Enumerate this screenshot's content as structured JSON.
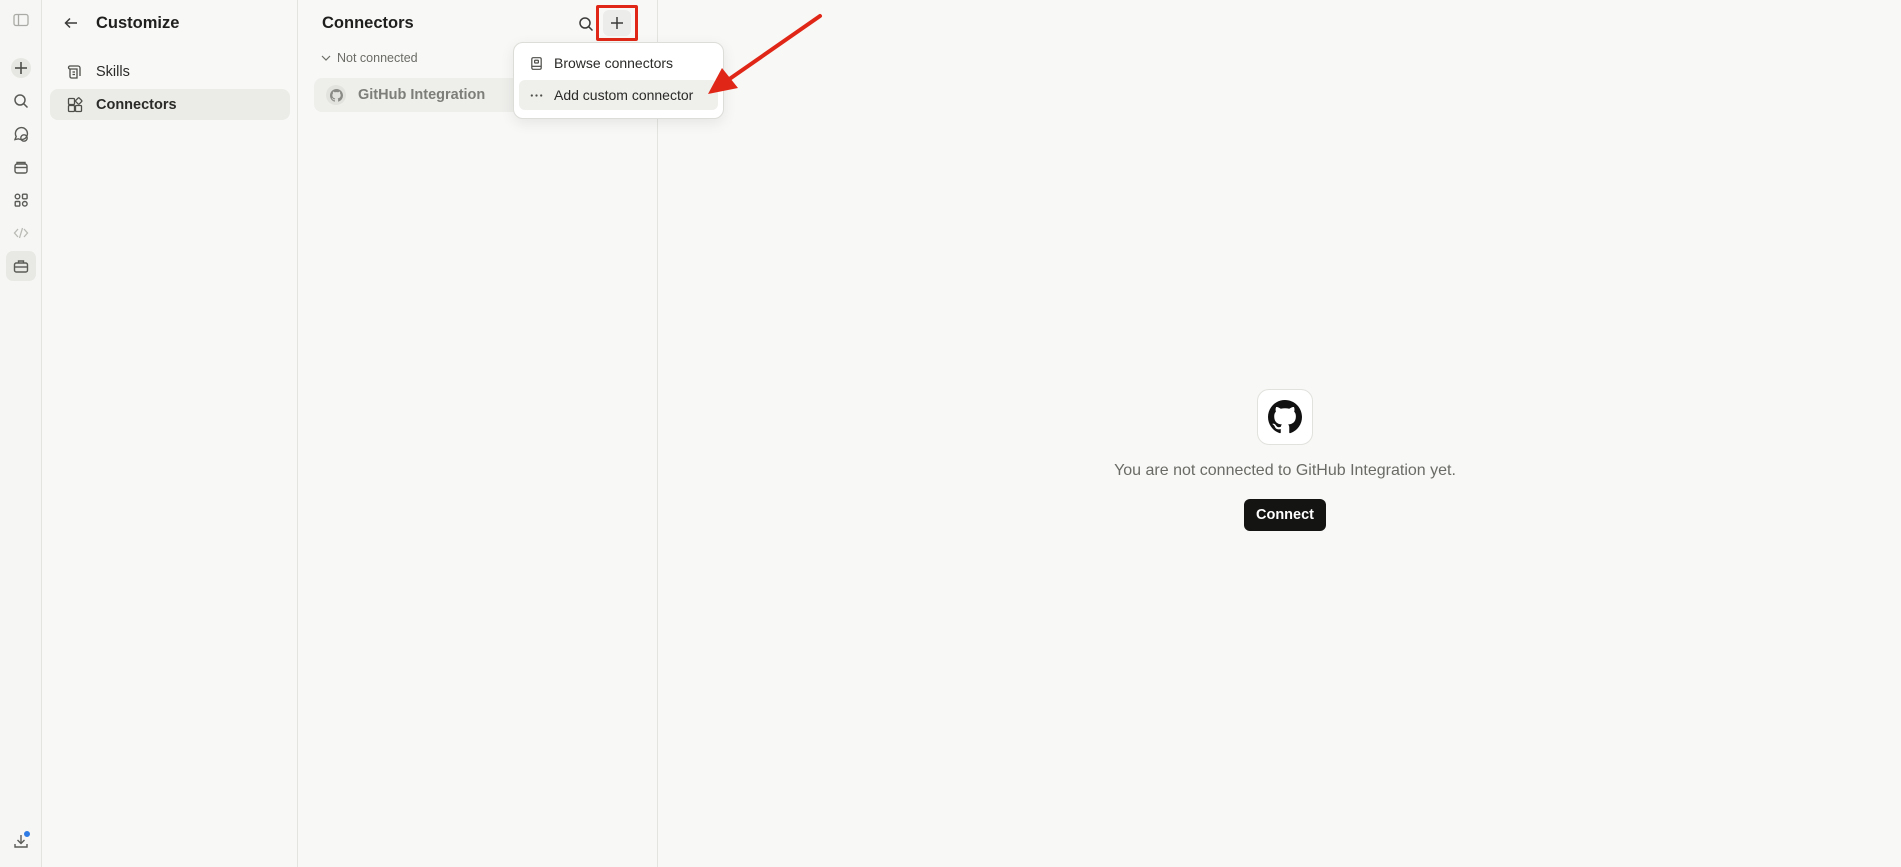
{
  "rail": {
    "items": [
      {
        "icon": "sidebar-toggle-icon"
      },
      {
        "icon": "plus-icon"
      },
      {
        "icon": "search-icon"
      },
      {
        "icon": "chat-icon"
      },
      {
        "icon": "projects-icon"
      },
      {
        "icon": "artifacts-icon"
      },
      {
        "icon": "code-icon"
      },
      {
        "icon": "toolbox-icon",
        "active": true
      }
    ],
    "bottom": {
      "icon": "download-icon",
      "badge_color": "#2f7be5"
    }
  },
  "customize": {
    "title": "Customize",
    "nav": [
      {
        "label": "Skills",
        "icon": "skills-icon"
      },
      {
        "label": "Connectors",
        "icon": "connectors-icon",
        "active": true
      }
    ]
  },
  "connectors": {
    "title": "Connectors",
    "group_label": "Not connected",
    "items": [
      {
        "label": "GitHub Integration",
        "icon": "github-icon"
      }
    ]
  },
  "menu": {
    "items": [
      {
        "label": "Browse connectors",
        "icon": "book-icon"
      },
      {
        "label": "Add custom connector",
        "icon": "more-horizontal-icon"
      }
    ]
  },
  "main": {
    "empty_text": "You are not connected to GitHub Integration yet.",
    "connect_label": "Connect"
  },
  "colors": {
    "annotation_red": "#e02717",
    "connect_button_bg": "#141413",
    "background": "#f8f8f6"
  }
}
